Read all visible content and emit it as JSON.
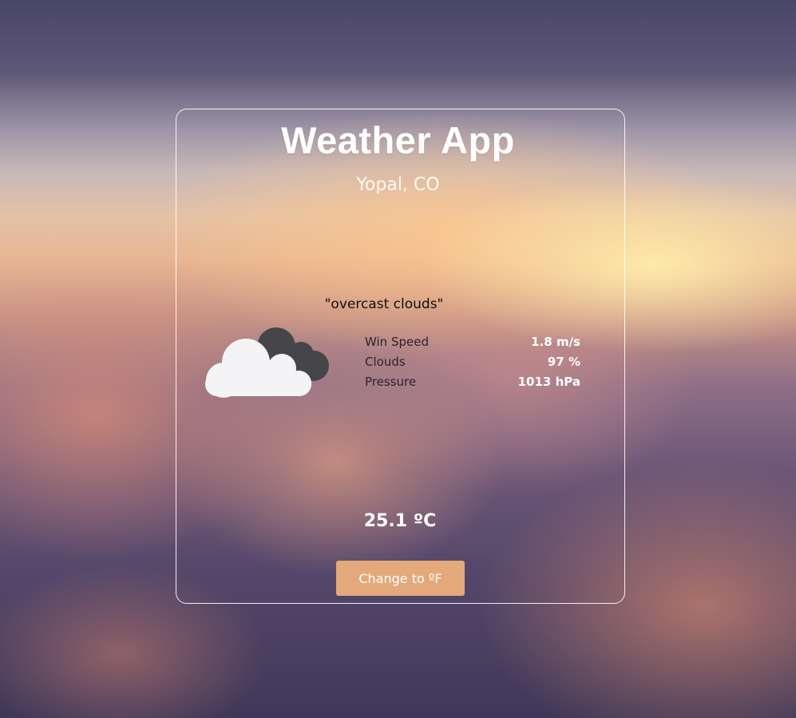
{
  "app": {
    "title": "Weather App",
    "location": "Yopal, CO"
  },
  "weather": {
    "description": "\"overcast clouds\"",
    "icon": "overcast-clouds-icon",
    "stats": [
      {
        "label": "Win Speed",
        "value": "1.8 m/s"
      },
      {
        "label": "Clouds",
        "value": "97 %"
      },
      {
        "label": "Pressure",
        "value": "1013 hPa"
      }
    ],
    "temperature": "25.1 ºC"
  },
  "controls": {
    "unit_button_label": "Change to ºF"
  },
  "colors": {
    "button": "#e3a97a",
    "text_primary": "#ffffff",
    "text_dark": "#111111"
  }
}
